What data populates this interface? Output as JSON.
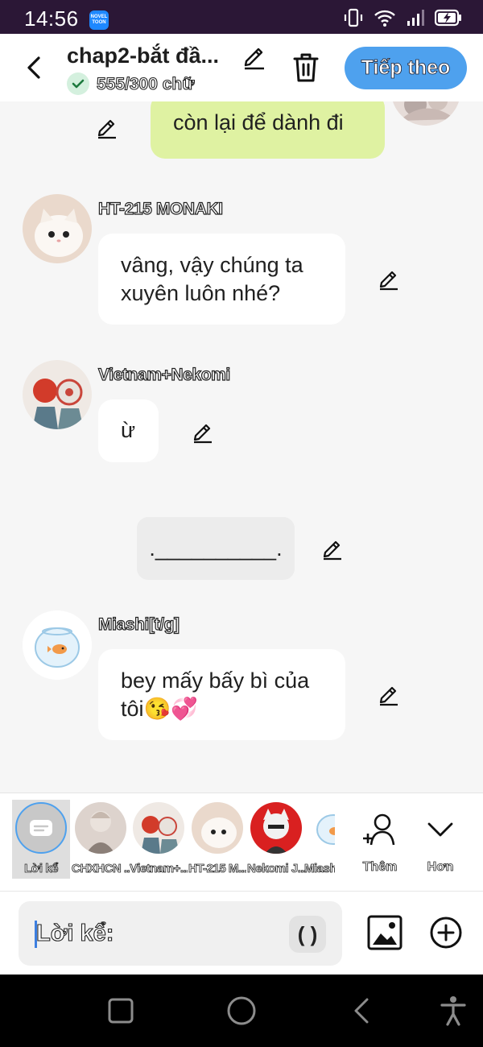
{
  "status_bar": {
    "time": "14:56",
    "app_badge": "NOVEL TOON"
  },
  "header": {
    "title": "chap2-bắt đầ...",
    "word_count": "555/300 chữ",
    "next_label": "Tiếp theo"
  },
  "messages": {
    "my_last": {
      "text": "còn lại để dành đi"
    },
    "m1": {
      "sender": "HT-215 MONAKI",
      "text": "vâng, vậy chúng ta xuyên luôn nhé?"
    },
    "m2": {
      "sender": "Vietnam+Nekomi",
      "text": "ừ"
    },
    "narration": {
      "text": ".__________."
    },
    "m3": {
      "sender": "Miashi[t/g]",
      "text": "bey mấy bấy bì của tôi😘💞"
    }
  },
  "characters": {
    "items": [
      {
        "name": "Lời kể",
        "selected": true
      },
      {
        "name": "CHXHCN ..."
      },
      {
        "name": "Vietnam+..."
      },
      {
        "name": "HT-215 M..."
      },
      {
        "name": "Nekomi J..."
      },
      {
        "name": "Miash"
      }
    ],
    "add_label": "Thêm",
    "more_label": "Hơn"
  },
  "composer": {
    "label": "Lời kể:",
    "paren_button": "( )"
  },
  "colors": {
    "accent": "#4ea1ee",
    "my_bubble": "#dff2a2",
    "status_bar": "#2b1736"
  }
}
